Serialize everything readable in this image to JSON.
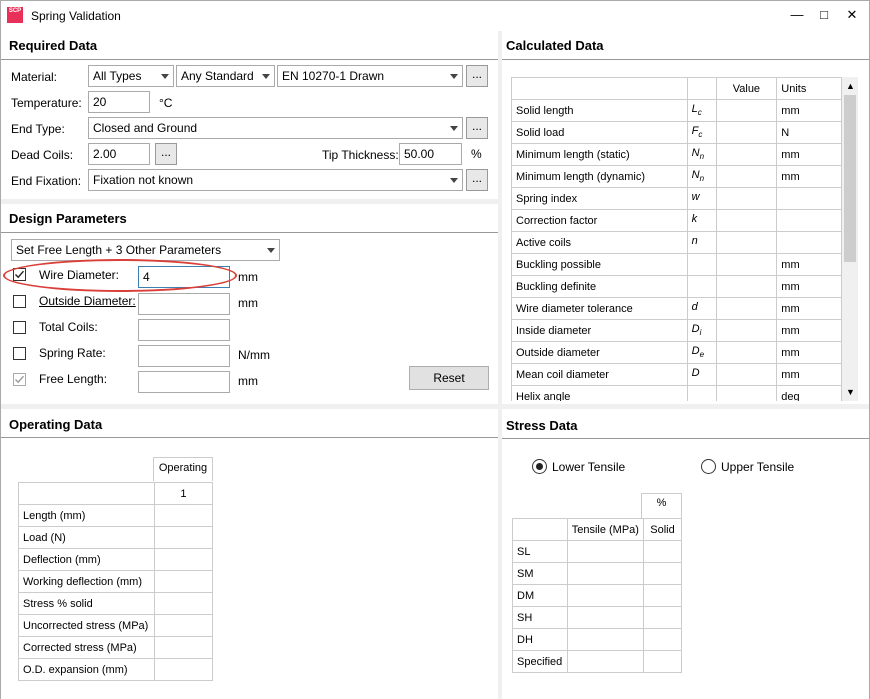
{
  "window": {
    "title": "Spring Validation",
    "icon_text": "SCP",
    "controls": [
      "minimize-icon",
      "maximize-icon",
      "close-icon"
    ]
  },
  "required": {
    "title": "Required Data",
    "material_label": "Material:",
    "material_type": "All Types",
    "material_standard": "Any Standard",
    "material_value": "EN 10270-1 Drawn",
    "temperature_label": "Temperature:",
    "temperature_value": "20",
    "temperature_unit": "°C",
    "end_type_label": "End Type:",
    "end_type_value": "Closed and Ground",
    "dead_coils_label": "Dead Coils:",
    "dead_coils_value": "2.00",
    "tip_thickness_label": "Tip Thickness:",
    "tip_thickness_value": "50.00",
    "tip_thickness_unit": "%",
    "end_fixation_label": "End Fixation:",
    "end_fixation_value": "Fixation not known",
    "browse_label": "..."
  },
  "design": {
    "title": "Design Parameters",
    "mode_value": "Set Free Length + 3 Other Parameters",
    "rows": [
      {
        "label": "Wire Diameter:",
        "value": "4",
        "unit": "mm",
        "checked": true
      },
      {
        "label": "Outside Diameter:",
        "value": "",
        "unit": "mm",
        "checked": false
      },
      {
        "label": "Total Coils:",
        "value": "",
        "unit": "",
        "checked": false
      },
      {
        "label": "Spring Rate:",
        "value": "",
        "unit": "N/mm",
        "checked": false
      },
      {
        "label": "Free Length:",
        "value": "",
        "unit": "mm",
        "checked": true
      }
    ],
    "reset_label": "Reset"
  },
  "calculated": {
    "title": "Calculated Data",
    "headers": [
      "",
      "",
      "Value",
      "Units"
    ],
    "rows": [
      {
        "name": "Solid length",
        "symbol": "L",
        "sub": "c",
        "unit": "mm"
      },
      {
        "name": "Solid load",
        "symbol": "F",
        "sub": "c",
        "unit": "N"
      },
      {
        "name": "Minimum length (static)",
        "symbol": "N",
        "sub": "n",
        "unit": "mm"
      },
      {
        "name": "Minimum length (dynamic)",
        "symbol": "N",
        "sub": "n",
        "unit": "mm"
      },
      {
        "name": "Spring index",
        "symbol": "w",
        "sub": "",
        "unit": ""
      },
      {
        "name": "Correction factor",
        "symbol": "k",
        "sub": "",
        "unit": ""
      },
      {
        "name": "Active coils",
        "symbol": "n",
        "sub": "",
        "unit": ""
      },
      {
        "name": "Buckling possible",
        "symbol": "",
        "sub": "",
        "unit": "mm"
      },
      {
        "name": "Buckling definite",
        "symbol": "",
        "sub": "",
        "unit": "mm"
      },
      {
        "name": "Wire diameter tolerance",
        "symbol": "d",
        "sub": "",
        "unit": "mm"
      },
      {
        "name": "Inside diameter",
        "symbol": "D",
        "sub": "i",
        "unit": "mm"
      },
      {
        "name": "Outside diameter",
        "symbol": "D",
        "sub": "e",
        "unit": "mm"
      },
      {
        "name": "Mean coil diameter",
        "symbol": "D",
        "sub": "",
        "unit": "mm"
      },
      {
        "name": "Helix angle",
        "symbol": "",
        "sub": "",
        "unit": "deg"
      }
    ]
  },
  "operating": {
    "title": "Operating Data",
    "column_header": "Operating",
    "column_number": "1",
    "rows": [
      "Length (mm)",
      "Load (N)",
      "Deflection (mm)",
      "Working deflection (mm)",
      "Stress % solid",
      "Uncorrected stress (MPa)",
      "Corrected stress (MPa)",
      "O.D. expansion (mm)"
    ]
  },
  "stress": {
    "title": "Stress Data",
    "lower_label": "Lower Tensile",
    "upper_label": "Upper Tensile",
    "selected": "lower",
    "pct_header": "%",
    "tensile_header": "Tensile (MPa)",
    "solid_header": "Solid",
    "rows": [
      "SL",
      "SM",
      "DM",
      "SH",
      "DH",
      "Specified"
    ]
  },
  "colors": {
    "highlight": "#d9403a",
    "icon_bg": "#e8305a"
  }
}
